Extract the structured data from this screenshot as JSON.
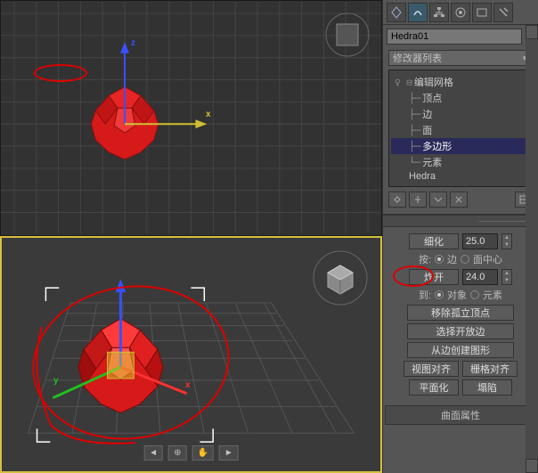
{
  "object_name": "Hedra01",
  "modifier_dropdown": "修改器列表",
  "stack": {
    "root": "编辑网格",
    "children": [
      "顶点",
      "边",
      "面",
      "多边形",
      "元素"
    ],
    "base": "Hedra",
    "selected": "多边形"
  },
  "panel": {
    "tessellate": "细化",
    "tess_value": "25.0",
    "by_label": "按:",
    "by_edge": "边",
    "by_face_center": "面中心",
    "explode": "炸开",
    "explode_value": "24.0",
    "to_label": "到:",
    "to_object": "对象",
    "to_element": "元素",
    "remove_iso": "移除孤立顶点",
    "select_open": "选择开放边",
    "create_shape": "从边创建图形",
    "view_align": "视图对齐",
    "grid_align": "栅格对齐",
    "planarize": "平面化",
    "collapse": "塌陷"
  },
  "rollout_header": "曲面属性",
  "colors": {
    "object": "#d61a1a",
    "swatch": "#8080c0"
  }
}
